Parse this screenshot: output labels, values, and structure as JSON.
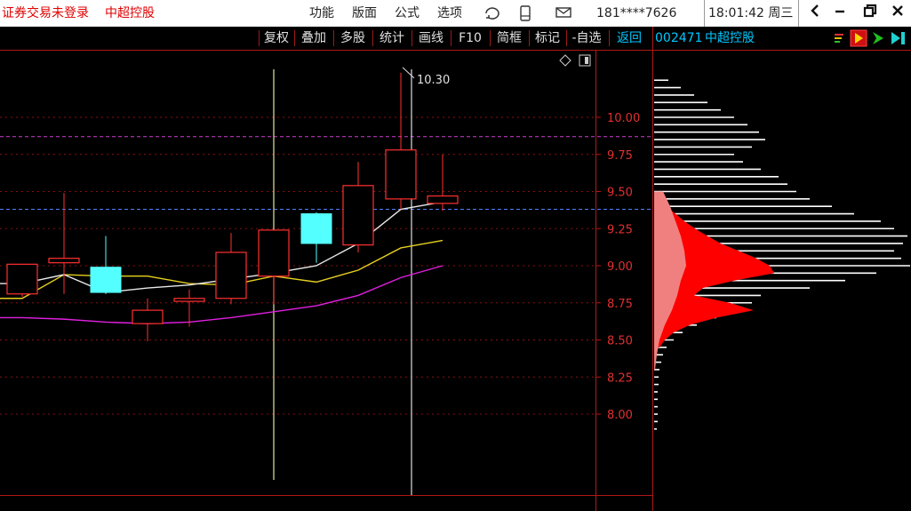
{
  "titlebar": {
    "status_text": "证券交易未登录",
    "stock_name": "中超控股",
    "menus": [
      "功能",
      "版面",
      "公式",
      "选项"
    ],
    "account": "181****7626",
    "clock": "18:01:42 周三"
  },
  "toolbar": {
    "buttons": [
      "复权",
      "叠加",
      "多股",
      "统计",
      "画线",
      "F10",
      "简框",
      "标记",
      "-自选"
    ],
    "return_label": "返回",
    "stock_code": "002471",
    "stock_name": "中超控股"
  },
  "chart_data": {
    "type": "candlestick",
    "y_ticks": [
      "10.00",
      "9.75",
      "9.50",
      "9.25",
      "9.00",
      "8.75",
      "8.50",
      "8.25",
      "8.00"
    ],
    "y_min": 7.8,
    "y_max": 10.4,
    "high_annotation": "10.30",
    "candles": [
      {
        "open": 8.81,
        "close": 9.01,
        "high": 9.01,
        "low": 8.79
      },
      {
        "open": 9.02,
        "close": 9.05,
        "high": 9.49,
        "low": 8.81
      },
      {
        "open": 8.99,
        "close": 8.82,
        "high": 9.2,
        "low": 8.81
      },
      {
        "open": 8.61,
        "close": 8.7,
        "high": 8.78,
        "low": 8.49
      },
      {
        "open": 8.76,
        "close": 8.78,
        "high": 8.84,
        "low": 8.59
      },
      {
        "open": 8.78,
        "close": 9.09,
        "high": 9.22,
        "low": 8.74
      },
      {
        "open": 8.93,
        "close": 9.24,
        "high": 9.24,
        "low": 8.74
      },
      {
        "open": 9.35,
        "close": 9.15,
        "high": 9.36,
        "low": 9.02
      },
      {
        "open": 9.14,
        "close": 9.54,
        "high": 9.7,
        "low": 9.09
      },
      {
        "open": 9.45,
        "close": 9.78,
        "high": 10.3,
        "low": 9.38
      },
      {
        "open": 9.42,
        "close": 9.47,
        "high": 9.75,
        "low": 9.37
      }
    ],
    "ma_white": [
      8.88,
      8.94,
      8.82,
      8.85,
      8.87,
      8.91,
      8.95,
      9.0,
      9.15,
      9.38,
      9.43
    ],
    "ma_yellow": [
      8.78,
      8.94,
      8.93,
      8.93,
      8.88,
      8.87,
      8.93,
      8.89,
      8.97,
      9.12,
      9.17
    ],
    "ma_magenta": [
      8.65,
      8.64,
      8.62,
      8.61,
      8.62,
      8.65,
      8.69,
      8.73,
      8.8,
      8.92,
      9.0
    ],
    "cost_level_pink": 9.87,
    "current_price_level": 9.38,
    "chip_profile": [
      {
        "p": 10.25,
        "w": 16
      },
      {
        "p": 10.2,
        "w": 30
      },
      {
        "p": 10.15,
        "w": 45
      },
      {
        "p": 10.1,
        "w": 60
      },
      {
        "p": 10.05,
        "w": 75
      },
      {
        "p": 10.0,
        "w": 90
      },
      {
        "p": 9.95,
        "w": 105
      },
      {
        "p": 9.9,
        "w": 118
      },
      {
        "p": 9.85,
        "w": 125
      },
      {
        "p": 9.8,
        "w": 110
      },
      {
        "p": 9.75,
        "w": 90
      },
      {
        "p": 9.7,
        "w": 100
      },
      {
        "p": 9.65,
        "w": 120
      },
      {
        "p": 9.6,
        "w": 140
      },
      {
        "p": 9.55,
        "w": 150
      },
      {
        "p": 9.5,
        "w": 160
      },
      {
        "p": 9.45,
        "w": 175
      },
      {
        "p": 9.4,
        "w": 200
      },
      {
        "p": 9.35,
        "w": 225
      },
      {
        "p": 9.3,
        "w": 255
      },
      {
        "p": 9.25,
        "w": 270
      },
      {
        "p": 9.2,
        "w": 285
      },
      {
        "p": 9.15,
        "w": 280
      },
      {
        "p": 9.1,
        "w": 270
      },
      {
        "p": 9.05,
        "w": 278
      },
      {
        "p": 9.0,
        "w": 288
      },
      {
        "p": 8.95,
        "w": 250
      },
      {
        "p": 8.9,
        "w": 215
      },
      {
        "p": 8.85,
        "w": 175
      },
      {
        "p": 8.8,
        "w": 120
      },
      {
        "p": 8.75,
        "w": 110
      },
      {
        "p": 8.7,
        "w": 90
      },
      {
        "p": 8.65,
        "w": 70
      },
      {
        "p": 8.6,
        "w": 48
      },
      {
        "p": 8.55,
        "w": 32
      },
      {
        "p": 8.5,
        "w": 22
      },
      {
        "p": 8.45,
        "w": 14
      },
      {
        "p": 8.4,
        "w": 10
      },
      {
        "p": 8.35,
        "w": 8
      },
      {
        "p": 8.3,
        "w": 6
      },
      {
        "p": 8.25,
        "w": 5
      },
      {
        "p": 8.2,
        "w": 5
      },
      {
        "p": 8.15,
        "w": 4
      },
      {
        "p": 8.1,
        "w": 4
      },
      {
        "p": 8.05,
        "w": 4
      },
      {
        "p": 8.0,
        "w": 4
      },
      {
        "p": 7.95,
        "w": 4
      },
      {
        "p": 7.9,
        "w": 3
      }
    ],
    "red_profile": [
      {
        "p": 9.45,
        "w": 6
      },
      {
        "p": 9.4,
        "w": 14
      },
      {
        "p": 9.35,
        "w": 24
      },
      {
        "p": 9.3,
        "w": 34
      },
      {
        "p": 9.25,
        "w": 46
      },
      {
        "p": 9.2,
        "w": 60
      },
      {
        "p": 9.15,
        "w": 75
      },
      {
        "p": 9.1,
        "w": 95
      },
      {
        "p": 9.05,
        "w": 115
      },
      {
        "p": 9.0,
        "w": 130
      },
      {
        "p": 8.95,
        "w": 135
      },
      {
        "p": 8.9,
        "w": 90
      },
      {
        "p": 8.85,
        "w": 55
      },
      {
        "p": 8.8,
        "w": 45
      },
      {
        "p": 8.75,
        "w": 85
      },
      {
        "p": 8.7,
        "w": 112
      },
      {
        "p": 8.65,
        "w": 70
      },
      {
        "p": 8.6,
        "w": 40
      },
      {
        "p": 8.55,
        "w": 22
      },
      {
        "p": 8.5,
        "w": 12
      },
      {
        "p": 8.45,
        "w": 6
      }
    ],
    "pink_profile": [
      {
        "p": 9.5,
        "w": 10
      },
      {
        "p": 9.4,
        "w": 18
      },
      {
        "p": 9.3,
        "w": 24
      },
      {
        "p": 9.2,
        "w": 30
      },
      {
        "p": 9.1,
        "w": 34
      },
      {
        "p": 9.0,
        "w": 36
      },
      {
        "p": 8.9,
        "w": 30
      },
      {
        "p": 8.8,
        "w": 26
      },
      {
        "p": 8.7,
        "w": 20
      },
      {
        "p": 8.6,
        "w": 12
      },
      {
        "p": 8.5,
        "w": 6
      },
      {
        "p": 8.4,
        "w": 3
      },
      {
        "p": 8.3,
        "w": 1
      }
    ]
  }
}
